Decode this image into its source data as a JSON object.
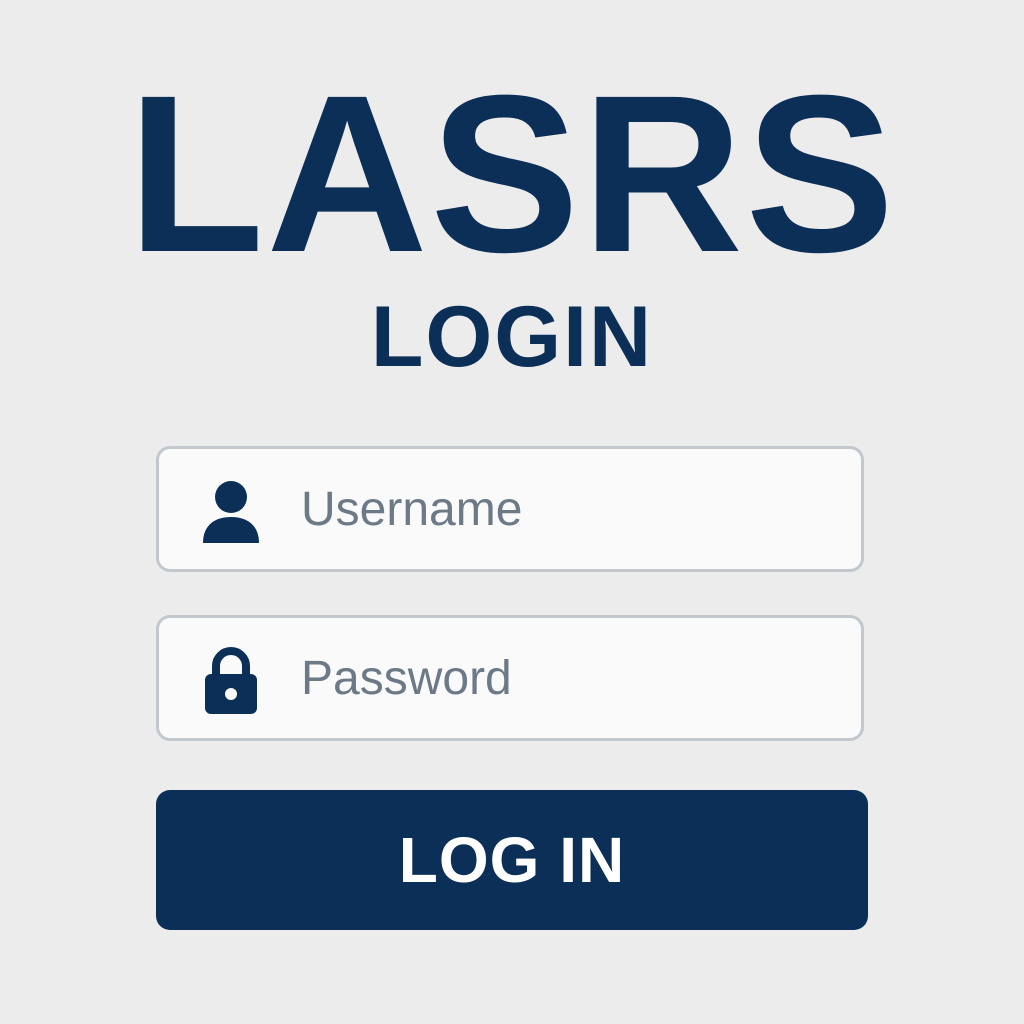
{
  "app": {
    "title": "LASRS",
    "subtitle": "LOGIN"
  },
  "form": {
    "username": {
      "icon": "user-icon",
      "placeholder": "Username",
      "value": ""
    },
    "password": {
      "icon": "lock-icon",
      "placeholder": "Password",
      "value": ""
    },
    "submit_label": "LOG IN"
  },
  "colors": {
    "brand": "#0c2f57",
    "background": "#ececec",
    "field_border": "#c3c8ce",
    "field_background": "#fafafa",
    "placeholder_text": "#6c7a88",
    "button_text": "#ffffff"
  }
}
